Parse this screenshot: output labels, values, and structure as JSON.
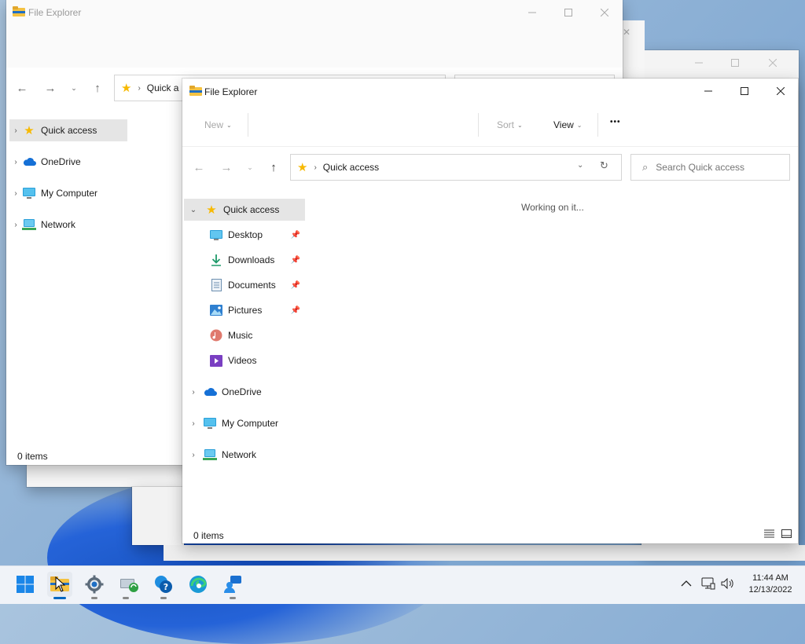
{
  "back_window_1": {
    "title": "File Explorer",
    "address": "Quick a",
    "nav": [
      "Quick access",
      "OneDrive",
      "My Computer",
      "Network"
    ],
    "status": "0 items"
  },
  "main_window": {
    "title": "File Explorer",
    "toolbar": {
      "new_label": "New",
      "sort_label": "Sort",
      "view_label": "View",
      "more_label": "•••"
    },
    "address": {
      "path": "Quick access"
    },
    "search": {
      "placeholder": "Search Quick access"
    },
    "content_message": "Working on it...",
    "tree": {
      "quick_access": "Quick access",
      "children": [
        {
          "label": "Desktop",
          "icon": "desktop-icon",
          "pinned": true
        },
        {
          "label": "Downloads",
          "icon": "downloads-icon",
          "pinned": true
        },
        {
          "label": "Documents",
          "icon": "documents-icon",
          "pinned": true
        },
        {
          "label": "Pictures",
          "icon": "pictures-icon",
          "pinned": true
        },
        {
          "label": "Music",
          "icon": "music-icon",
          "pinned": false
        },
        {
          "label": "Videos",
          "icon": "videos-icon",
          "pinned": false
        }
      ],
      "onedrive": "OneDrive",
      "my_computer": "My Computer",
      "network": "Network"
    },
    "status": "0 items"
  },
  "taskbar": {
    "time": "11:44 AM",
    "date": "12/13/2022",
    "pinned": [
      "start-icon",
      "file-explorer-icon",
      "settings-icon",
      "network-sync-icon",
      "help-icon",
      "edge-icon",
      "people-icon"
    ]
  },
  "colors": {
    "accent": "#0067c0",
    "selected_bg": "#e5e5e5",
    "star": "#f7b900",
    "folder": "#f4c242"
  }
}
